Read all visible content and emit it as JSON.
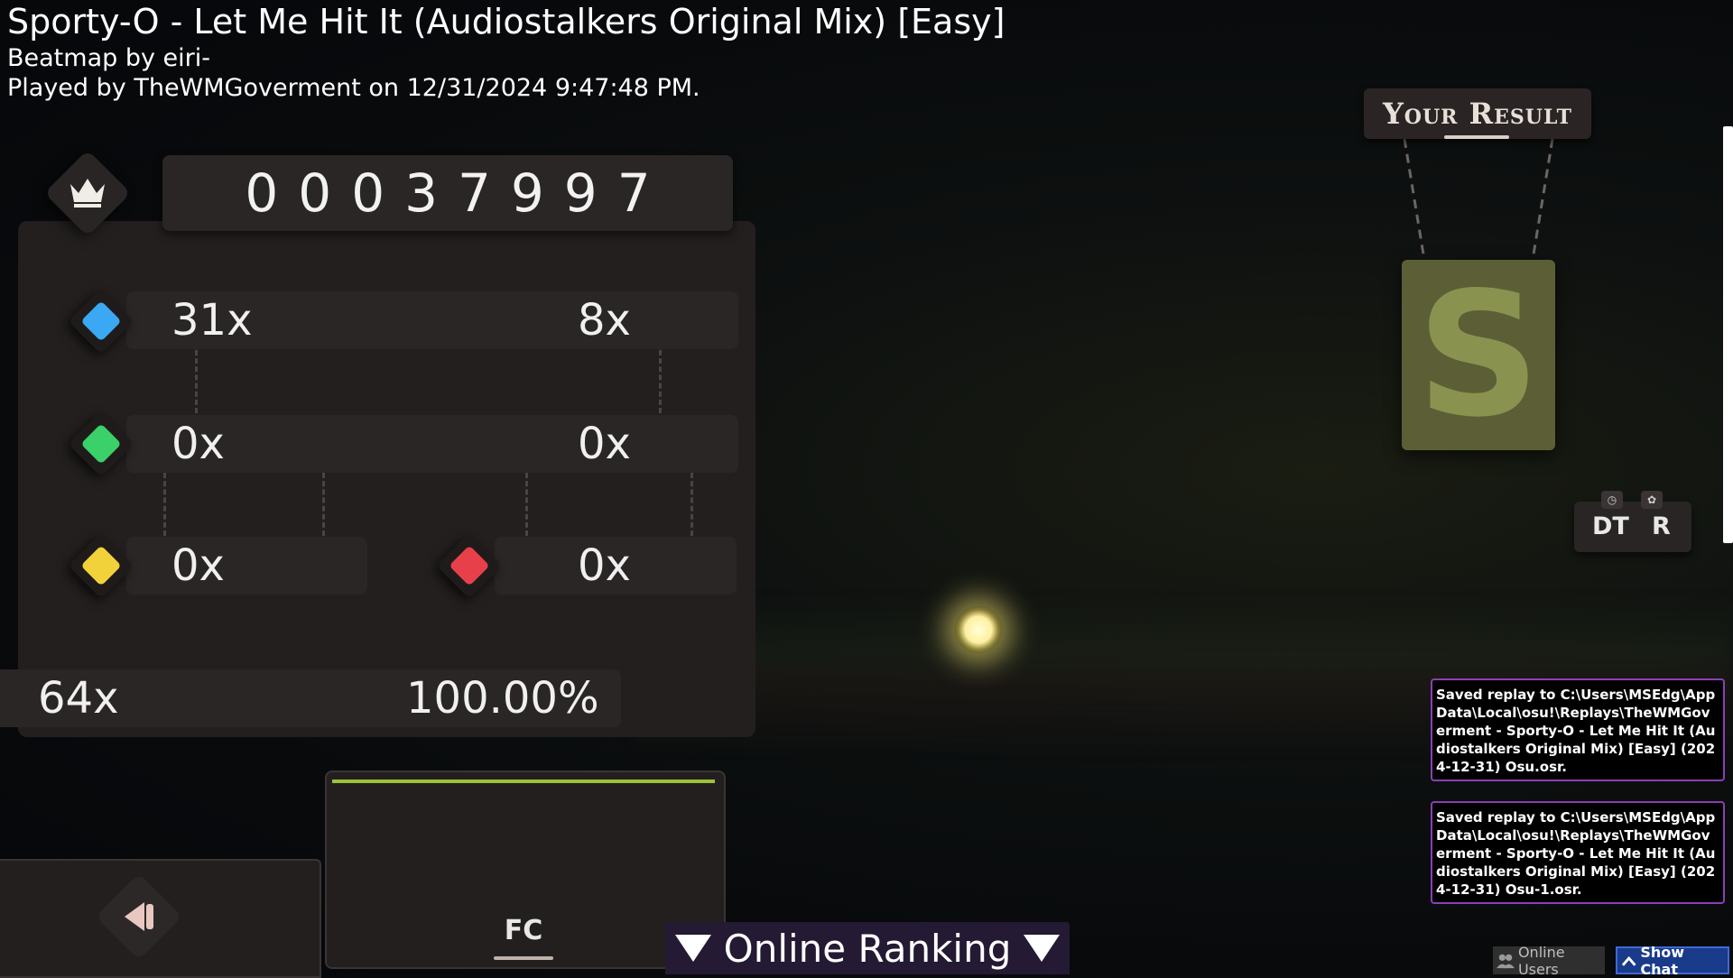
{
  "header": {
    "title": "Sporty-O - Let Me Hit It (Audiostalkers Original Mix) [Easy]",
    "beatmap_by": "Beatmap by eiri-",
    "played_by": "Played by TheWMGoverment on 12/31/2024 9:47:48 PM."
  },
  "score": {
    "value": "00037997"
  },
  "judgements": {
    "great": "31x",
    "geki": "8x",
    "ok": "0x",
    "katu": "0x",
    "meh": "0x",
    "miss": "0x"
  },
  "summary": {
    "max_combo": "64x",
    "accuracy": "100.00%"
  },
  "graph": {
    "label": "FC"
  },
  "online_ranking": {
    "label": "Online Ranking"
  },
  "result": {
    "title": "Your Result",
    "rank": "S"
  },
  "mods": {
    "dt": "DT",
    "r": "R"
  },
  "notifications": [
    {
      "text": "Saved replay to C:\\Users\\MSEdg\\AppData\\Local\\osu!\\Replays\\TheWMGoverment - Sporty-O - Let Me Hit It (Audiostalkers Original Mix) [Easy] (2024-12-31) Osu.osr."
    },
    {
      "text": "Saved replay to C:\\Users\\MSEdg\\AppData\\Local\\osu!\\Replays\\TheWMGoverment - Sporty-O - Let Me Hit It (Audiostalkers Original Mix) [Easy] (2024-12-31) Osu-1.osr."
    }
  ],
  "bottom_buttons": {
    "online_users": "Online Users",
    "show_chat": "Show Chat"
  },
  "colors": {
    "great_gem": "#3aa8f2",
    "ok_gem": "#3ad06a",
    "meh_gem": "#f2d23a",
    "miss_gem": "#e8404a",
    "accent_purple": "#8b3fb6",
    "graph_line": "#9ac43a"
  },
  "icons": {
    "crown": "crown-icon",
    "back": "back-arrow-icon",
    "triangle": "triangle-down-icon",
    "users": "users-icon",
    "chevron": "chevron-up-icon"
  }
}
